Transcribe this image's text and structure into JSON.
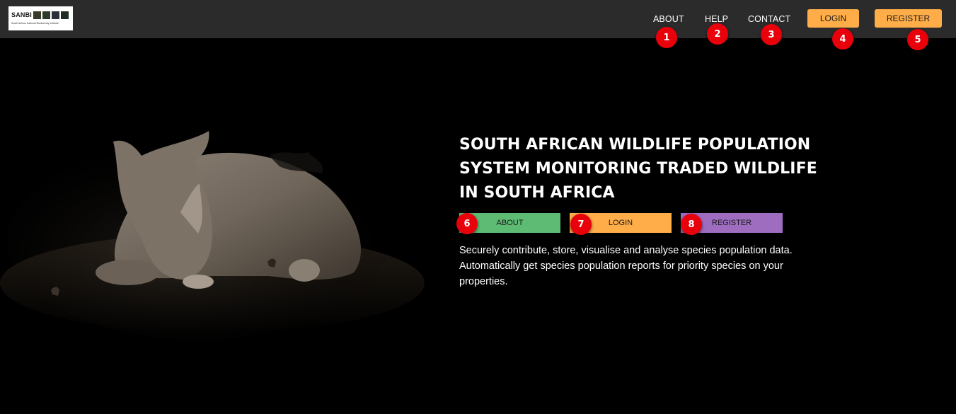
{
  "header": {
    "logo": {
      "name": "SANBI",
      "subtitle": "South African National Biodiversity Institute"
    },
    "nav": {
      "about": "ABOUT",
      "help": "HELP",
      "contact": "CONTACT",
      "login": "LOGIN",
      "register": "REGISTER"
    }
  },
  "markers": [
    "1",
    "2",
    "3",
    "4",
    "5",
    "6",
    "7",
    "8"
  ],
  "hero": {
    "title": "SOUTH AFRICAN WILDLIFE POPULATION SYSTEM MONITORING TRADED WILDLIFE IN SOUTH AFRICA",
    "buttons": {
      "about": "ABOUT",
      "login": "LOGIN",
      "register": "REGISTER"
    },
    "description": "Securely contribute, store, visualise and analyse species population data. Automatically get species population reports for priority species on your properties."
  },
  "colors": {
    "topbar": "#2b2b2b",
    "accent_orange": "#ffad48",
    "about_green": "#5dbb74",
    "register_purple": "#9e6dc0",
    "marker_red": "#e8000b"
  }
}
